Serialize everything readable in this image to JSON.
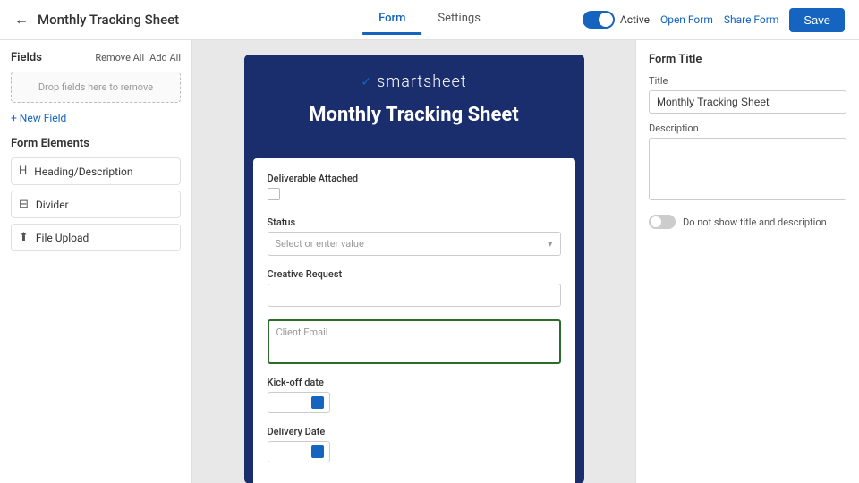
{
  "header": {
    "back_label": "←",
    "title": "Monthly Tracking Sheet",
    "tabs": [
      {
        "label": "Form",
        "active": true
      },
      {
        "label": "Settings",
        "active": false
      }
    ],
    "toggle_label": "Active",
    "open_form_label": "Open Form",
    "share_form_label": "Share Form",
    "save_label": "Save"
  },
  "sidebar": {
    "fields_title": "Fields",
    "remove_all_label": "Remove All",
    "add_all_label": "Add All",
    "drop_zone_label": "Drop fields here to remove",
    "add_field_label": "+ New Field",
    "form_elements_title": "Form Elements",
    "elements": [
      {
        "icon": "H",
        "label": "Heading/Description"
      },
      {
        "icon": "⊟",
        "label": "Divider"
      },
      {
        "icon": "⬆",
        "label": "File Upload"
      }
    ]
  },
  "canvas": {
    "logo_mark": "✓",
    "logo_text": "smartsheet",
    "form_title": "Monthly Tracking Sheet",
    "fields": [
      {
        "label": "Deliverable Attached",
        "type": "checkbox"
      },
      {
        "label": "Status",
        "type": "select",
        "placeholder": "Select or enter value"
      },
      {
        "label": "Creative Request",
        "type": "input"
      },
      {
        "label": "Client Email",
        "type": "textarea",
        "focused": true
      },
      {
        "label": "Kick-off date",
        "type": "date"
      },
      {
        "label": "Delivery Date",
        "type": "date"
      }
    ]
  },
  "right_panel": {
    "section_title": "Form Title",
    "title_label": "Title",
    "title_value": "Monthly Tracking Sheet",
    "description_label": "Description",
    "description_value": "",
    "toggle_label": "Do not show title and description"
  }
}
